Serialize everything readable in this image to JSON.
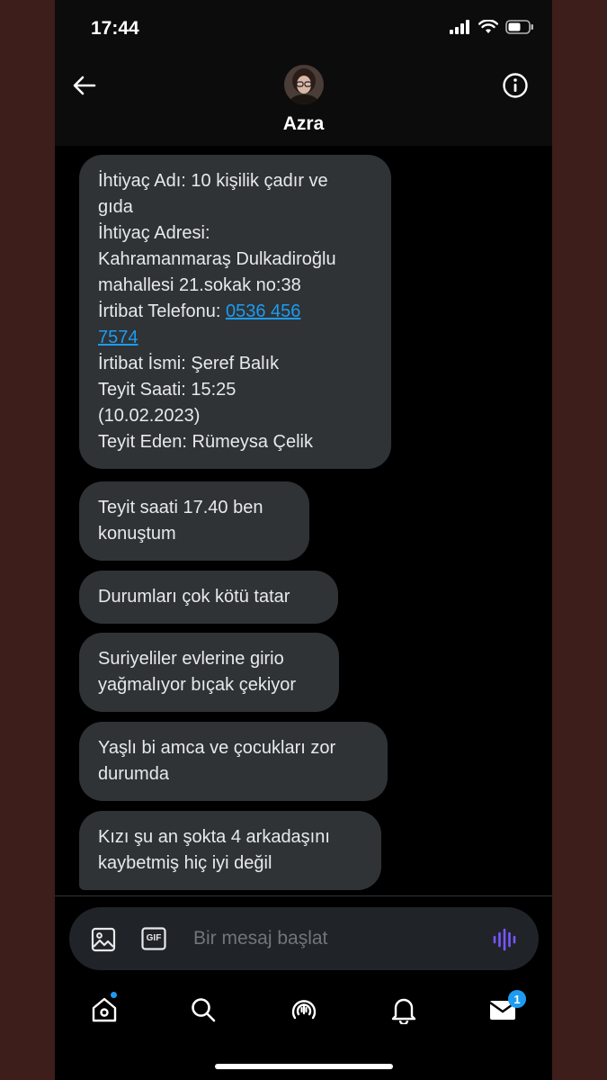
{
  "status_bar": {
    "time": "17:44"
  },
  "header": {
    "contact_name": "Azra"
  },
  "messages": [
    {
      "lines": [
        "İhtiyaç Adı: 10 kişilik çadır ve",
        "gıda",
        "İhtiyaç Adresi:",
        "Kahramanmaraş Dulkadiroğlu",
        "mahallesi 21.sokak no:38"
      ]
    },
    {
      "label": "İrtibat Telefonu: ",
      "phone_line1": "0536 456",
      "phone_line2": "7574"
    },
    {
      "lines": [
        "İrtibat İsmi: Şeref Balık",
        "Teyit Saati: 15:25",
        "(10.02.2023)",
        "Teyit Eden: Rümeysa Çelik"
      ]
    },
    {
      "lines": [
        "Teyit saati 17.40 ben",
        "konuştum"
      ]
    },
    {
      "lines": [
        "Durumları çok kötü tatar"
      ]
    },
    {
      "lines": [
        "Suriyeliler evlerine girio",
        "yağmalıyor bıçak çekiyor"
      ]
    },
    {
      "lines": [
        "Yaşlı bi amca ve çocukları zor",
        "durumda"
      ]
    },
    {
      "lines": [
        "Kızı şu an şokta 4 arkadaşını",
        "kaybetmiş hiç iyi değil"
      ]
    }
  ],
  "composer": {
    "placeholder": "Bir mesaj başlat",
    "gif_label": "GIF"
  },
  "nav": {
    "messages_badge": "1"
  },
  "colors": {
    "accent": "#1d9bf0",
    "bubble": "#2f3336",
    "background": "#000000",
    "voice": "#7856ff"
  }
}
